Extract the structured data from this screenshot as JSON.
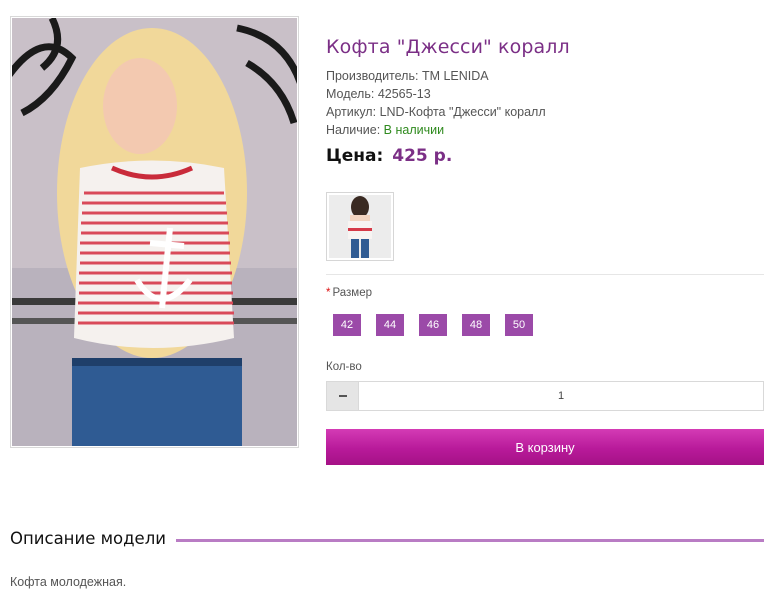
{
  "product": {
    "title": "Кофта \"Джесси\" коралл",
    "manufacturer_label": "Производитель:",
    "manufacturer": "TM LENIDA",
    "model_label": "Модель:",
    "model": "42565-13",
    "sku_label": "Артикул:",
    "sku": "LND-Кофта \"Джесси\" коралл",
    "availability_label": "Наличие:",
    "availability": "В наличии",
    "price_label": "Цена:",
    "price": "425 р."
  },
  "options": {
    "required_mark": "*",
    "size_label": "Размер",
    "sizes": [
      "42",
      "44",
      "46",
      "48",
      "50"
    ]
  },
  "quantity": {
    "label": "Кол-во",
    "value": "1"
  },
  "cart_button": "В корзину",
  "description": {
    "title": "Описание модели",
    "text": "Кофта молодежная."
  },
  "colors": {
    "accent": "#7b2f86",
    "size_button": "#9b4aa8",
    "cart_button": "#b81a9a",
    "in_stock": "#2f8a1e"
  },
  "icons": {
    "quantity_decrease": "minus-icon"
  }
}
